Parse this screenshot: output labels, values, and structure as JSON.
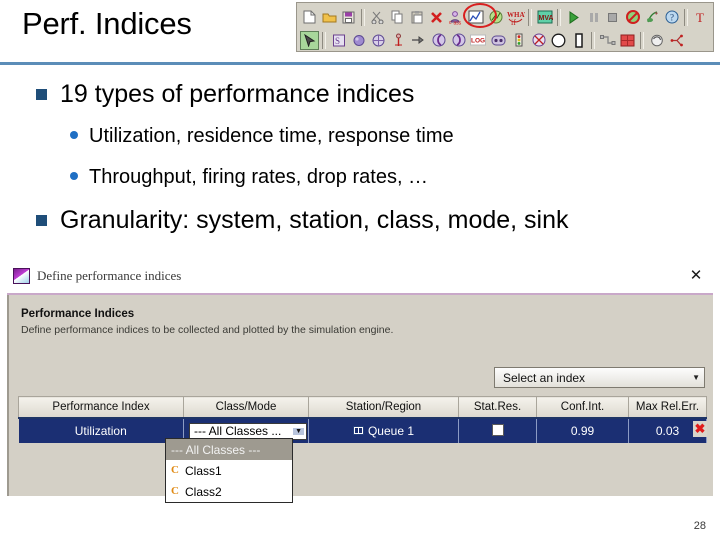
{
  "slide": {
    "title": "Perf. Indices",
    "page_number": "28",
    "accent_color": "#5b8db8",
    "bullet_color_level1": "#1f4e79",
    "bullet_color_level2": "#1f6fc4"
  },
  "bullets": [
    {
      "level": 1,
      "text": "19 types of performance indices"
    },
    {
      "level": 2,
      "text": "Utilization, residence time, response time"
    },
    {
      "level": 2,
      "text": "Throughput, firing rates, drop rates, …"
    },
    {
      "level": 1,
      "text": "Granularity: system, station, class, mode, sink"
    }
  ],
  "toolbar": {
    "highlight_color": "#d81f1f",
    "row1": [
      {
        "icon": "new-document-icon"
      },
      {
        "icon": "open-folder-icon"
      },
      {
        "icon": "save-icon"
      },
      {
        "icon": "separator"
      },
      {
        "icon": "cut-icon"
      },
      {
        "icon": "copy-icon"
      },
      {
        "icon": "paste-icon"
      },
      {
        "icon": "delete-x-icon"
      },
      {
        "icon": "class-define-icon"
      },
      {
        "icon": "performance-indices-icon"
      },
      {
        "icon": "plot-results-icon"
      },
      {
        "icon": "what-if-icon"
      },
      {
        "icon": "separator"
      },
      {
        "icon": "pmva-solve-icon"
      },
      {
        "icon": "separator"
      },
      {
        "icon": "play-icon"
      },
      {
        "icon": "pause-icon"
      },
      {
        "icon": "stop-icon"
      },
      {
        "icon": "abort-icon"
      },
      {
        "icon": "randomize-icon"
      },
      {
        "icon": "help-icon"
      },
      {
        "icon": "separator"
      },
      {
        "icon": "text-tool-icon"
      }
    ],
    "row2": [
      {
        "icon": "select-arrow-icon",
        "selected": true
      },
      {
        "icon": "separator"
      },
      {
        "icon": "source-station-icon"
      },
      {
        "icon": "fork-icon"
      },
      {
        "icon": "queue-station-icon"
      },
      {
        "icon": "delay-station-icon"
      },
      {
        "icon": "arrow-link-icon"
      },
      {
        "icon": "join-left-icon"
      },
      {
        "icon": "join-right-icon"
      },
      {
        "icon": "logger-icon"
      },
      {
        "icon": "class-switch-icon"
      },
      {
        "icon": "semaphore-icon"
      },
      {
        "icon": "scaler-icon"
      },
      {
        "icon": "place-icon"
      },
      {
        "icon": "transition-icon"
      },
      {
        "icon": "separator"
      },
      {
        "icon": "connect-icon"
      },
      {
        "icon": "blocking-region-icon"
      },
      {
        "icon": "separator"
      },
      {
        "icon": "rotate-icon"
      },
      {
        "icon": "branch-icon"
      }
    ]
  },
  "dialog": {
    "title": "Define performance indices",
    "title_icon": "application-icon",
    "close_label": "✕",
    "panel": {
      "heading": "Performance Indices",
      "subtitle": "Define performance indices to be collected and plotted by the simulation engine."
    },
    "index_select": {
      "value": "Select an index",
      "caret": "▼"
    },
    "table": {
      "columns": [
        "Performance Index",
        "Class/Mode",
        "Station/Region",
        "Stat.Res.",
        "Conf.Int.",
        "Max Rel.Err."
      ],
      "rows": [
        {
          "performance_index": "Utilization",
          "class_mode": "--- All Classes ...",
          "class_mode_caret": "▼",
          "station_region": "Queue 1",
          "stat_res_checked": false,
          "conf_int": "0.99",
          "max_rel_err": "0.03",
          "delete_label": "✖"
        }
      ]
    },
    "class_dropdown": {
      "options": [
        {
          "label": "--- All Classes ---",
          "selected": true,
          "icon": null
        },
        {
          "label": "Class1",
          "selected": false,
          "icon": "class-icon",
          "glyph": "C"
        },
        {
          "label": "Class2",
          "selected": false,
          "icon": "class-icon",
          "glyph": "C"
        }
      ]
    }
  }
}
